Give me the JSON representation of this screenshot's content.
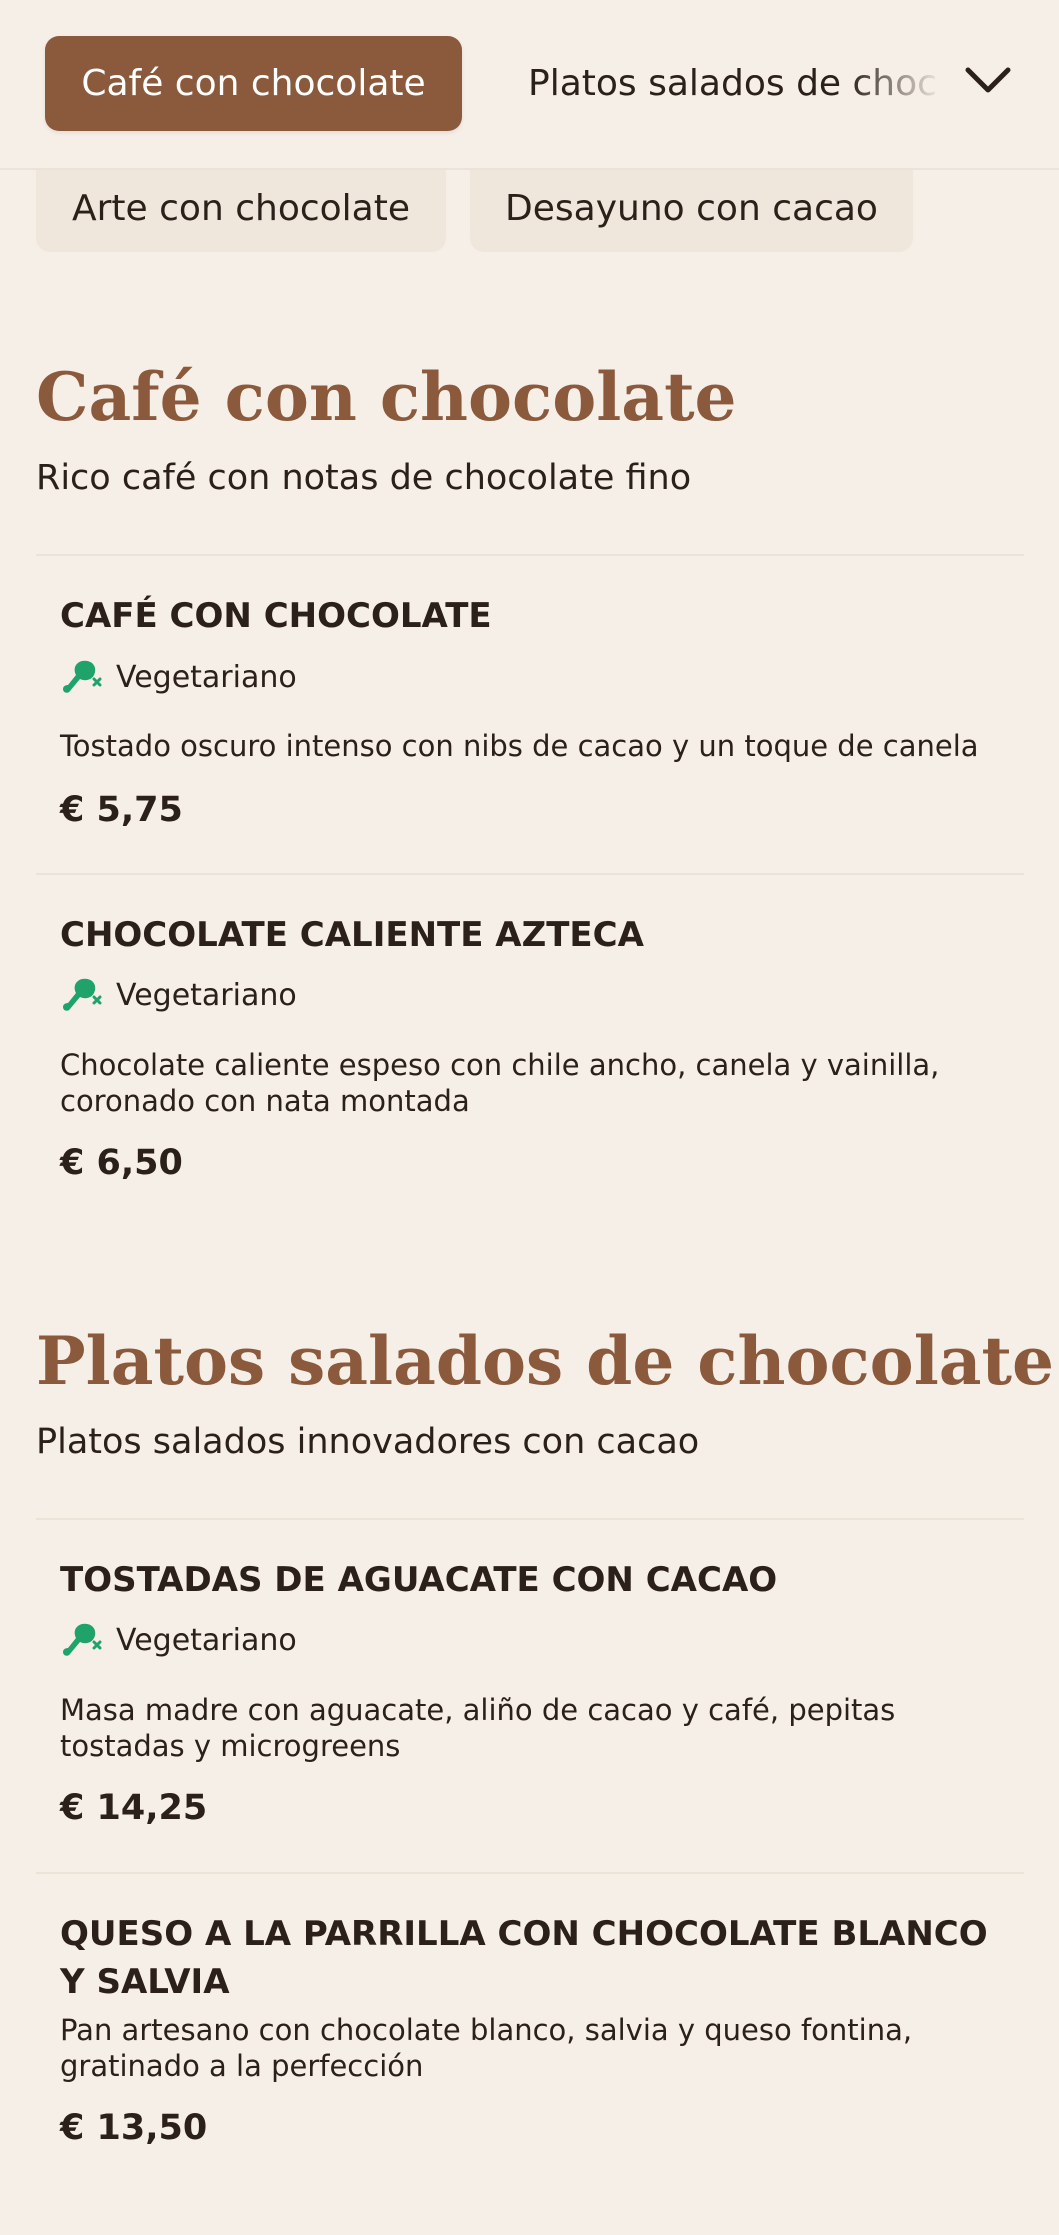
{
  "nav": {
    "active_tab": "Café con chocolate",
    "inline_tab": "Platos salados de chocolate",
    "row2": [
      "Arte con chocolate",
      "Desayuno con cacao"
    ]
  },
  "sections": [
    {
      "title": "Café con chocolate",
      "subtitle": "Rico café con notas de chocolate fino",
      "items": [
        {
          "name": "CAFÉ CON CHOCOLATE",
          "tag": "Vegetariano",
          "description": "Tostado oscuro intenso con nibs de cacao y un toque de canela",
          "price": "€ 5,75"
        },
        {
          "name": "CHOCOLATE CALIENTE AZTECA",
          "tag": "Vegetariano",
          "description": "Chocolate caliente espeso con chile ancho, canela y vainilla, coronado con nata montada",
          "price": "€ 6,50"
        }
      ]
    },
    {
      "title": "Platos salados de chocolate",
      "subtitle": "Platos salados innovadores con cacao",
      "items": [
        {
          "name": "TOSTADAS DE AGUACATE CON CACAO",
          "tag": "Vegetariano",
          "description": "Masa madre con aguacate, aliño de cacao y café, pepitas tostadas y microgreens",
          "price": "€ 14,25"
        },
        {
          "name": "QUESO A LA PARRILLA CON CHOCOLATE BLANCO Y SALVIA",
          "description": "Pan artesano con chocolate blanco, salvia y queso fontina, gratinado a la perfección",
          "price": "€ 13,50"
        }
      ]
    }
  ],
  "colors": {
    "background": "#f6efe7",
    "accent": "#8b5a3c",
    "veg_green": "#1fa36b"
  },
  "icons": {
    "veg": "vegetarian-drumstick-icon",
    "dropdown": "chevron-down-icon"
  }
}
